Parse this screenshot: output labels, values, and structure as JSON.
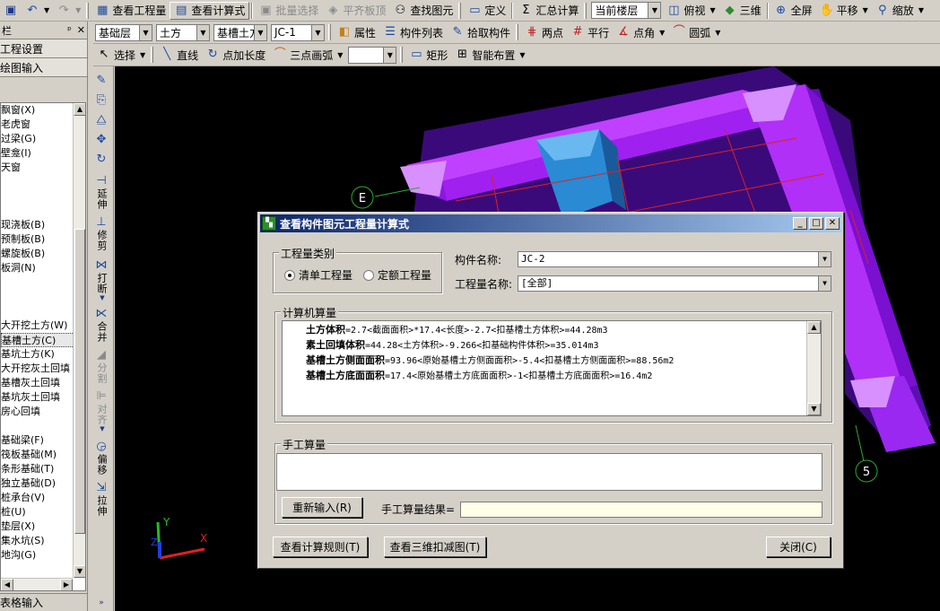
{
  "toolbar1": {
    "view_quantity": "查看工程量",
    "view_formula": "查看计算式",
    "batch_select": "批量选择",
    "align_slab_top": "平齐板顶",
    "find_element": "查找图元",
    "define": "定义",
    "summary_calc": "汇总计算",
    "floor_select": "当前楼层",
    "top_view": "俯视",
    "three_d": "三维",
    "full_screen": "全屏",
    "pan": "平移",
    "zoom": "缩放"
  },
  "toolbar2": {
    "layer": "基础层",
    "category": "土方",
    "component_type": "基槽土方",
    "component": "JC-1",
    "properties": "属性",
    "component_list": "构件列表",
    "pick_component": "拾取构件",
    "two_points": "两点",
    "parallel": "平行",
    "point_angle": "点角",
    "arc": "圆弧"
  },
  "toolbar3": {
    "select": "选择",
    "line": "直线",
    "point_length": "点加长度",
    "three_point_arc": "三点画弧",
    "rect": "矩形",
    "smart_layout": "智能布置"
  },
  "left_panel": {
    "header": "栏",
    "project_settings": "工程设置",
    "drawing_input": "绘图输入",
    "items": [
      "飘窗(X)",
      "老虎窗",
      "过梁(G)",
      "壁龛(I)",
      "天窗",
      "",
      "",
      "",
      "现浇板(B)",
      "预制板(B)",
      "螺旋板(B)",
      "板洞(N)",
      "",
      "",
      "",
      "大开挖土方(W)",
      "基槽土方(C)",
      "基坑土方(K)",
      "大开挖灰土回填",
      "基槽灰土回填",
      "基坑灰土回填",
      "房心回填",
      "",
      "基础梁(F)",
      "筏板基础(M)",
      "条形基础(T)",
      "独立基础(D)",
      "桩承台(V)",
      "桩(U)",
      "垫层(X)",
      "集水坑(S)",
      "地沟(G)"
    ],
    "selected_index": 16,
    "table_input": "表格输入"
  },
  "vertical_tools": {
    "extend": "延伸",
    "trim": "修剪",
    "break": "打断",
    "merge": "合并",
    "split": "分割",
    "align": "对齐",
    "offset": "偏移",
    "stretch": "拉伸"
  },
  "viewport": {
    "axis_e": "E",
    "axis_5": "5",
    "axis_x": "X",
    "axis_y": "Y",
    "axis_z": "Z"
  },
  "dialog": {
    "title": "查看构件图元工程量计算式",
    "quantity_category": "工程量类别",
    "radio_bill": "清单工程量",
    "radio_quota": "定额工程量",
    "component_name_label": "构件名称:",
    "component_name_value": "JC-2",
    "quantity_name_label": "工程量名称:",
    "quantity_name_value": "[全部]",
    "computer_calc": "计算机算量",
    "calc_lines": [
      {
        "name": "土方体积",
        "formula": "=2.7<截面面积>*17.4<长度>-2.7<扣基槽土方体积>=44.28m3"
      },
      {
        "name": "素土回填体积",
        "formula": "=44.28<土方体积>-9.266<扣基础构件体积>=35.014m3"
      },
      {
        "name": "基槽土方侧面面积",
        "formula": "=93.96<原始基槽土方侧面面积>-5.4<扣基槽土方侧面面积>=88.56m2"
      },
      {
        "name": "基槽土方底面面积",
        "formula": "=17.4<原始基槽土方底面面积>-1<扣基槽土方底面面积>=16.4m2"
      }
    ],
    "manual_calc": "手工算量",
    "reenter": "重新输入(R)",
    "manual_result_label": "手工算量结果=",
    "view_rules": "查看计算规则(T)",
    "view_3d_deduction": "查看三维扣减图(T)",
    "close": "关闭(C)"
  },
  "colors": {
    "title_active": "#0a246a",
    "viewport_bg": "#000000",
    "foundation": "#a020f0",
    "foundation_light": "#d070ff",
    "selected": "#2a8ad4"
  }
}
